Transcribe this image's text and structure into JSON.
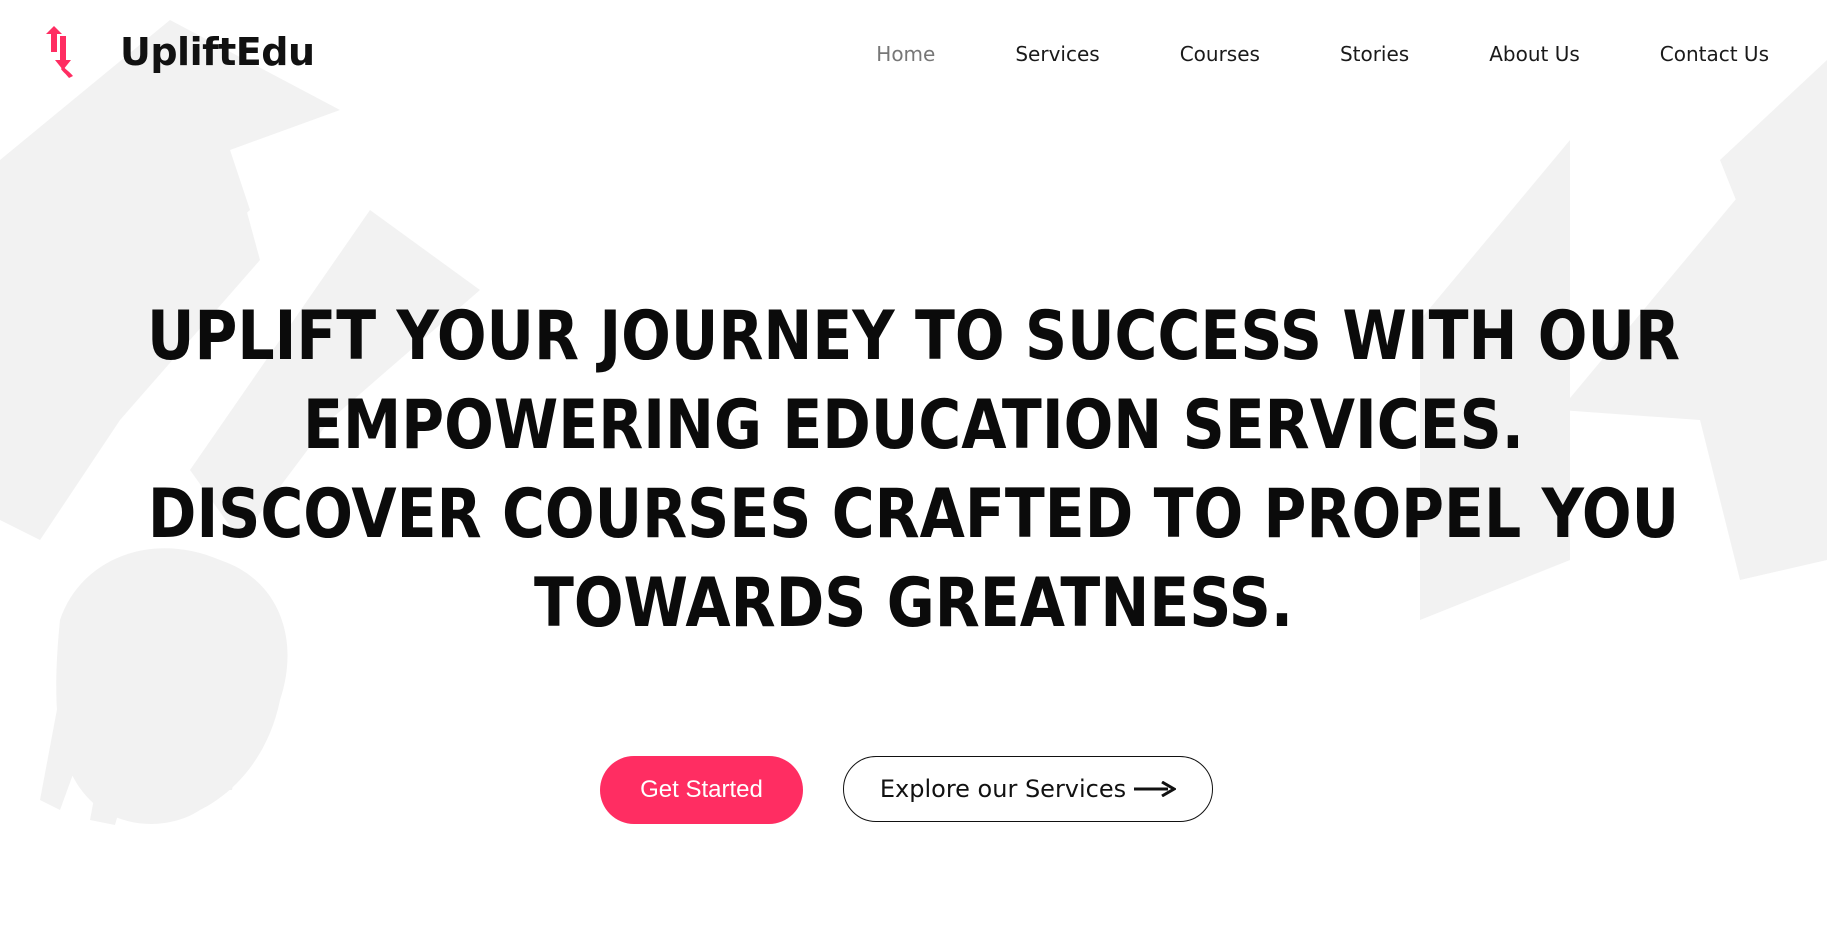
{
  "brand": {
    "name": "UpliftEdu",
    "accent_color": "#ff2d62",
    "logo_icon": "uplift-arrows-logo-icon"
  },
  "nav": {
    "items": [
      {
        "label": "Home",
        "active": true
      },
      {
        "label": "Services",
        "active": false
      },
      {
        "label": "Courses",
        "active": false
      },
      {
        "label": "Stories",
        "active": false
      },
      {
        "label": "About Us",
        "active": false
      },
      {
        "label": "Contact Us",
        "active": false
      }
    ]
  },
  "hero": {
    "lines": [
      "UPLIFT YOUR JOURNEY TO SUCCESS WITH OUR",
      "EMPOWERING EDUCATION SERVICES.",
      "DISCOVER COURSES CRAFTED TO PROPEL YOU",
      "TOWARDS GREATNESS."
    ]
  },
  "actions": {
    "primary_label": "Get Started",
    "secondary_label": "Explore our Services",
    "secondary_icon": "arrow-right-icon"
  }
}
